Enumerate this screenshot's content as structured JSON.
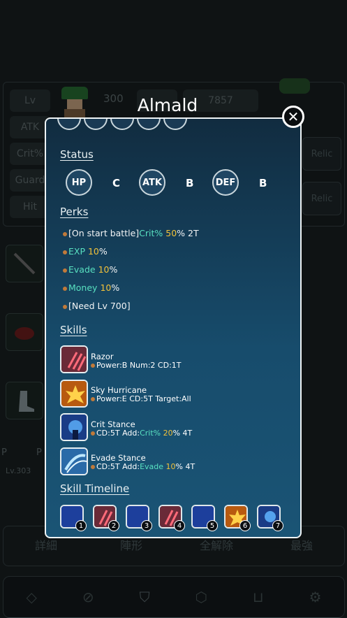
{
  "background": {
    "stats": {
      "lv_label": "Lv",
      "lv_value": "300",
      "power_value": "7857",
      "atk_label": "ATK",
      "crit_label": "Crit%",
      "guard_label": "Guard",
      "hit_label": "Hit",
      "relic_labels": [
        "Relic",
        "Relic"
      ]
    },
    "side_text": [
      "P",
      "P",
      "Lv.303"
    ],
    "bottom_buttons": [
      "詳細",
      "陣形",
      "全解除",
      "最強"
    ],
    "nav_icons": [
      "diamond-icon",
      "compass-icon",
      "character-icon",
      "cube-icon",
      "cart-icon",
      "gear-icon"
    ]
  },
  "popup": {
    "name": "Almald",
    "close_label": "✕",
    "status": {
      "title": "Status",
      "items": [
        {
          "stat": "HP",
          "grade": "C"
        },
        {
          "stat": "ATK",
          "grade": "B"
        },
        {
          "stat": "DEF",
          "grade": "B"
        }
      ]
    },
    "perks": {
      "title": "Perks",
      "items": [
        {
          "pre": "[On start battle]",
          "key": "Crit%",
          "val": "50",
          "post": "% 2T"
        },
        {
          "pre": "",
          "key": "EXP",
          "val": "10",
          "post": "%"
        },
        {
          "pre": "",
          "key": "Evade",
          "val": "10",
          "post": "%"
        },
        {
          "pre": "",
          "key": "Money",
          "val": "10",
          "post": "%"
        },
        {
          "pre": "[Need Lv 700]",
          "key": "",
          "val": "",
          "post": ""
        }
      ]
    },
    "skills": {
      "title": "Skills",
      "items": [
        {
          "name": "Razor",
          "desc": "Power:B Num:2 CD:1T",
          "icon": "claw-icon"
        },
        {
          "name": "Sky Hurricane",
          "desc": "Power:E CD:5T Target:All",
          "icon": "fire-burst-icon"
        },
        {
          "name": "Crit Stance",
          "desc_pre": "CD:5T Add:",
          "desc_key": "Crit%",
          "desc_val": "20",
          "desc_post": "%  4T",
          "icon": "stance-icon"
        },
        {
          "name": "Evade Stance",
          "desc_pre": "CD:5T Add:",
          "desc_key": "Evade",
          "desc_val": "10",
          "desc_post": "%  4T",
          "icon": "ice-wind-icon"
        }
      ]
    },
    "timeline": {
      "title": "Skill Timeline",
      "slots": [
        {
          "num": "1",
          "type": "blue"
        },
        {
          "num": "2",
          "type": "claw"
        },
        {
          "num": "3",
          "type": "blue"
        },
        {
          "num": "4",
          "type": "claw"
        },
        {
          "num": "5",
          "type": "blue"
        },
        {
          "num": "6",
          "type": "fire"
        },
        {
          "num": "7",
          "type": "stance"
        }
      ]
    }
  }
}
